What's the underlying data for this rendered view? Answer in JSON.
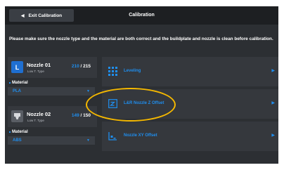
{
  "topbar": {
    "exit_label": "Exit Calibration",
    "title": "Calibration"
  },
  "notice": "Please make sure the nozzle type and the material are both correct and the buildplate and nozzle is clean before calibration.",
  "nozzles": [
    {
      "badge": "L",
      "name": "Nozzle 01",
      "type": "Low T. Type",
      "temp_current": "210",
      "temp_separator": " / ",
      "temp_target": "215",
      "material_label": "Material",
      "material_value": "PLA"
    },
    {
      "badge": "",
      "name": "Nozzle 02",
      "type": "Low T. Type",
      "temp_current": "149",
      "temp_separator": " / ",
      "temp_target": "150",
      "material_label": "Material",
      "material_value": "ABS"
    }
  ],
  "menu": [
    {
      "label": "Leveling",
      "icon": "grid-icon"
    },
    {
      "label": "L&R Nozzle Z Offset",
      "icon": "z-offset-icon"
    },
    {
      "label": "Nozzle XY Offset",
      "icon": "xy-axis-icon"
    }
  ],
  "colors": {
    "accent": "#1f8ff0",
    "highlight": "#f5b800",
    "background": "#2c2f33",
    "topbar": "#1d1f22"
  }
}
